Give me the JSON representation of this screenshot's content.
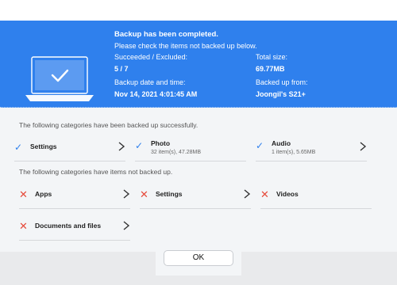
{
  "header": {
    "title": "Backup has been completed.",
    "subtitle": "Please check the items not backed up below.",
    "succeeded_label": "Succeeded / Excluded:",
    "succeeded_value": "5 / 7",
    "total_size_label": "Total size:",
    "total_size_value": "69.77MB",
    "date_label": "Backup date and time:",
    "date_value": "Nov 14, 2021 4:01:45 AM",
    "from_label": "Backed up from:",
    "from_value": "Joongil's S21+"
  },
  "success_section": {
    "label": "The following categories have been backed up successfully.",
    "items": [
      {
        "name": "Settings",
        "sub": ""
      },
      {
        "name": "Photo",
        "sub": "32 item(s), 47.28MB"
      },
      {
        "name": "Audio",
        "sub": "1 item(s), 5.65MB"
      }
    ]
  },
  "failed_section": {
    "label": "The following categories have items not backed up.",
    "items": [
      {
        "name": "Apps"
      },
      {
        "name": "Settings"
      },
      {
        "name": "Videos"
      },
      {
        "name": "Documents and files"
      }
    ]
  },
  "footer": {
    "ok_label": "OK"
  },
  "colors": {
    "accent": "#2f80ed",
    "error": "#e64a3b"
  },
  "icons": {
    "success": "check-icon",
    "failure": "x-icon",
    "device": "laptop-icon",
    "more": "chevron-right-icon"
  }
}
